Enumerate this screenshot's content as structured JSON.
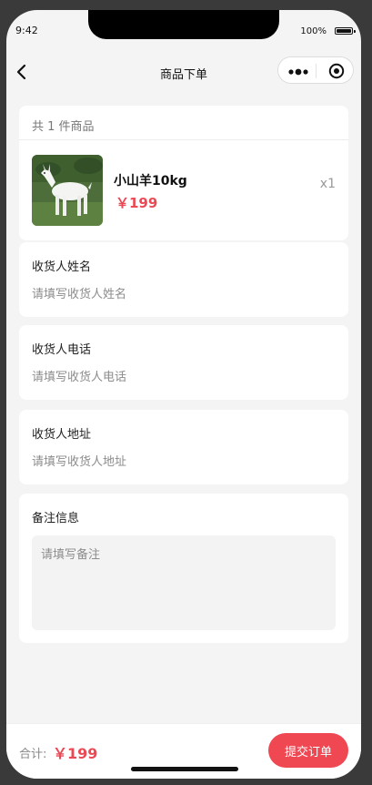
{
  "status_bar": {
    "time": "9:42",
    "battery_percent": "100%",
    "battery_level": 1.0
  },
  "navbar": {
    "title": "商品下单",
    "back_icon": "chevron-left-icon",
    "more_icon": "more-dots-icon",
    "close_icon": "target-circle-icon"
  },
  "goods": {
    "count_text": "共 1 件商品",
    "items": [
      {
        "name": "小山羊10kg",
        "price": "￥199",
        "quantity": "x1",
        "image": "white-goat-photo"
      }
    ]
  },
  "form": {
    "fields": [
      {
        "label": "收货人姓名",
        "placeholder": "请填写收货人姓名",
        "value": ""
      },
      {
        "label": "收货人电话",
        "placeholder": "请填写收货人电话",
        "value": ""
      },
      {
        "label": "收货人地址",
        "placeholder": "请填写收货人地址",
        "value": ""
      }
    ],
    "remark": {
      "label": "备注信息",
      "placeholder": "请填写备注",
      "value": ""
    }
  },
  "footer": {
    "total_label": "合计:",
    "total_value": "￥199",
    "submit_label": "提交订单"
  },
  "colors": {
    "accent": "#ef4853",
    "price": "#ea4a55",
    "page_background": "#f4f4f4",
    "card_background": "#ffffff"
  }
}
